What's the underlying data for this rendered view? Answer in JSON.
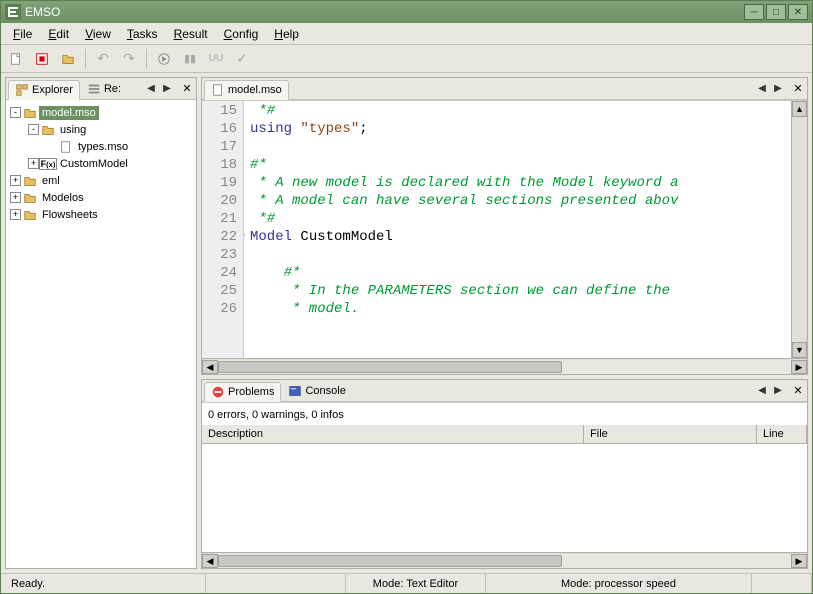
{
  "title": "EMSO",
  "menu": [
    "File",
    "Edit",
    "View",
    "Tasks",
    "Result",
    "Config",
    "Help"
  ],
  "explorer": {
    "tab_label": "Explorer",
    "tab2_label": "Re:",
    "tree": [
      {
        "depth": 0,
        "exp": "-",
        "icon": "folder",
        "label": "model.mso",
        "selected": true
      },
      {
        "depth": 1,
        "exp": "-",
        "icon": "folder",
        "label": "using"
      },
      {
        "depth": 2,
        "exp": "",
        "icon": "file",
        "label": "types.mso"
      },
      {
        "depth": 1,
        "exp": "+",
        "icon": "fx",
        "label": "CustomModel"
      },
      {
        "depth": 0,
        "exp": "+",
        "icon": "folder",
        "label": "eml"
      },
      {
        "depth": 0,
        "exp": "+",
        "icon": "folder",
        "label": "Modelos"
      },
      {
        "depth": 0,
        "exp": "+",
        "icon": "folder",
        "label": "Flowsheets"
      }
    ]
  },
  "editor": {
    "tab_label": "model.mso",
    "lines": [
      {
        "n": 15,
        "t": " *#",
        "cls": "c-comment"
      },
      {
        "n": 16,
        "html": "<span class='c-key'>using</span> <span class='c-str'>\"types\"</span>;"
      },
      {
        "n": 17,
        "t": ""
      },
      {
        "n": 18,
        "t": "#*",
        "cls": "c-comment"
      },
      {
        "n": 19,
        "t": " * A new model is declared with the Model keyword a",
        "cls": "c-comment"
      },
      {
        "n": 20,
        "t": " * A model can have several sections presented abov",
        "cls": "c-comment"
      },
      {
        "n": 21,
        "t": " *#",
        "cls": "c-comment"
      },
      {
        "n": 22,
        "html": "<span class='c-key'>Model</span> CustomModel",
        "fold": true
      },
      {
        "n": 23,
        "t": ""
      },
      {
        "n": 24,
        "t": "    #*",
        "cls": "c-comment"
      },
      {
        "n": 25,
        "t": "     * In the PARAMETERS section we can define the ",
        "cls": "c-comment"
      },
      {
        "n": 26,
        "t": "     * model.",
        "cls": "c-comment"
      }
    ]
  },
  "problems": {
    "tab1": "Problems",
    "tab2": "Console",
    "status": "0 errors, 0 warnings, 0 infos",
    "cols": [
      "Description",
      "File",
      "Line"
    ]
  },
  "status": {
    "ready": "Ready.",
    "mode1": "Mode: Text Editor",
    "mode2": "Mode: processor speed"
  }
}
